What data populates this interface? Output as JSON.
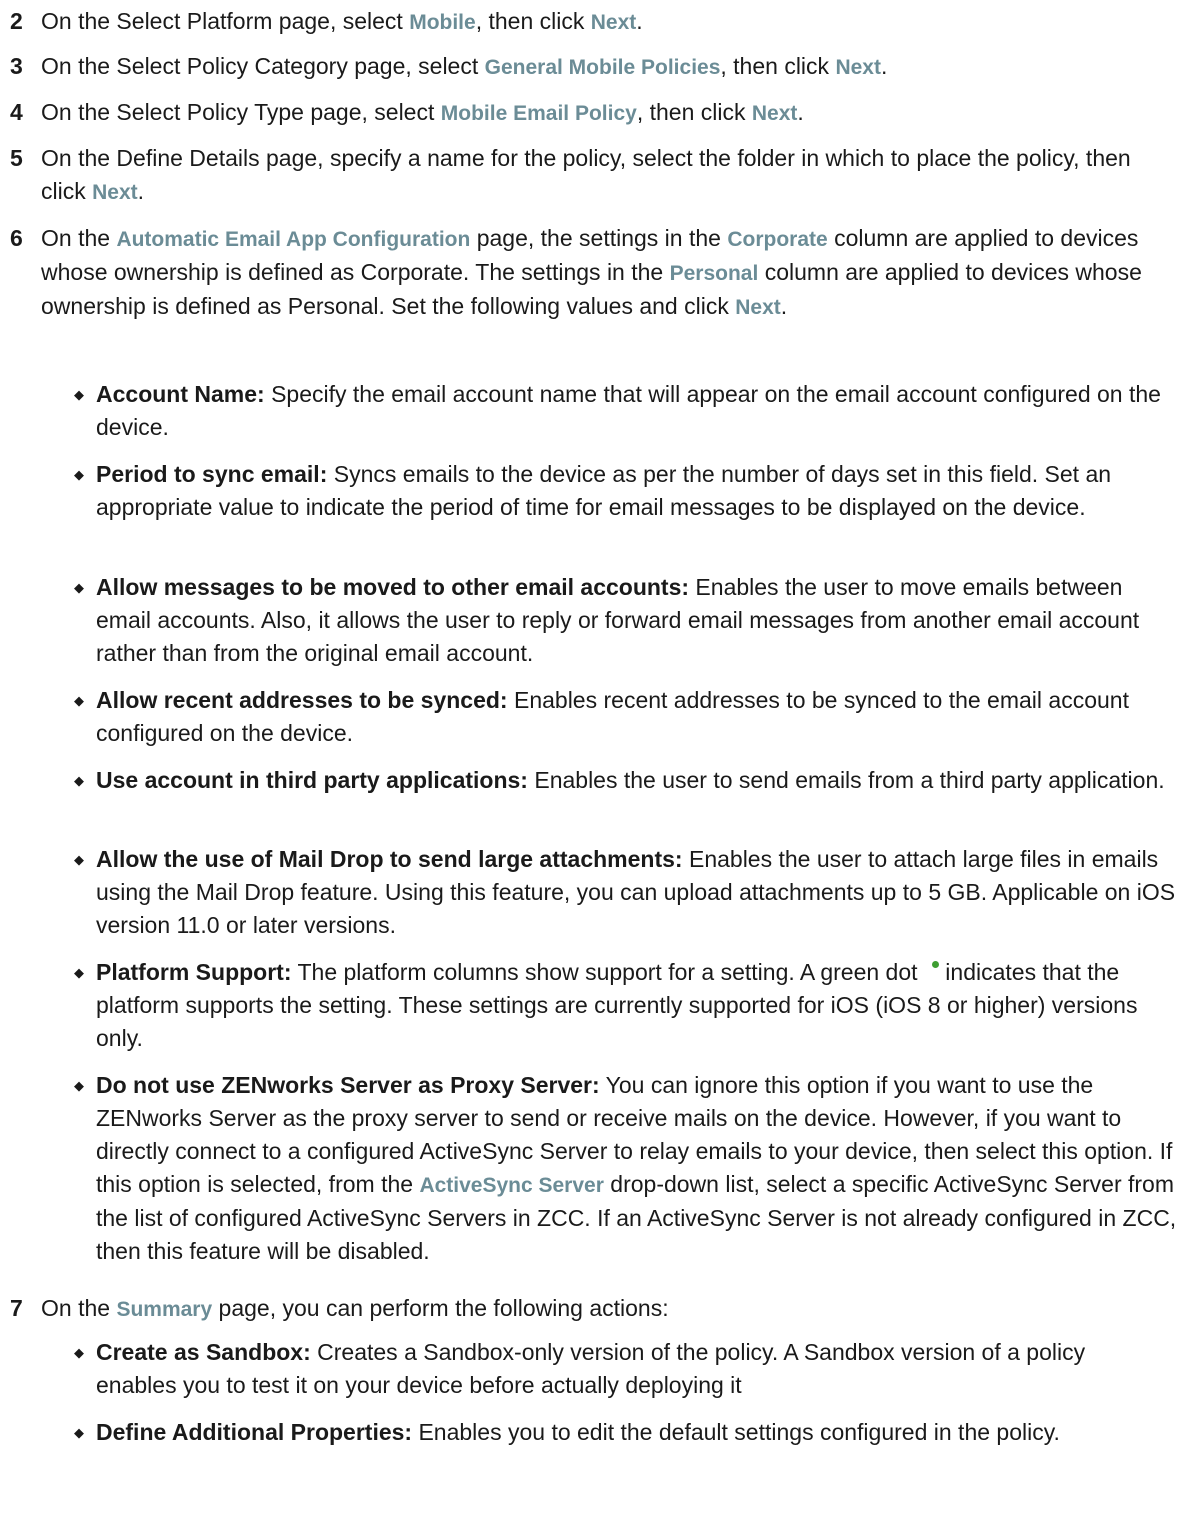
{
  "steps": [
    {
      "num": "2",
      "parts": [
        "On the Select Platform page, select ",
        "Mobile",
        ", then click ",
        "Next",
        "."
      ]
    },
    {
      "num": "3",
      "parts": [
        "On the Select Policy Category page, select ",
        "General Mobile Policies",
        ", then click ",
        "Next",
        "."
      ]
    },
    {
      "num": "4",
      "parts": [
        "On the Select Policy Type page, select ",
        "Mobile Email Policy",
        ", then click ",
        "Next",
        "."
      ]
    },
    {
      "num": "5",
      "parts": [
        "On the Define Details page, specify a name for the policy, select the folder in which to place the policy, then click ",
        "Next",
        "."
      ]
    },
    {
      "num": "6",
      "parts": [
        "On the ",
        "Automatic Email App Configuration",
        " page, the settings in the ",
        "Corporate",
        " column are applied to devices whose ownership is defined as Corporate. The settings in the ",
        "Personal",
        " column are applied to devices whose ownership is defined as Personal. Set the following values and click ",
        "Next",
        "."
      ]
    },
    {
      "num": "7",
      "parts": [
        "On the ",
        "Summary",
        " page, you can perform the following actions:"
      ]
    }
  ],
  "step6_bullets": [
    {
      "term": "Account Name:",
      "text": " Specify the email account name that will appear on the email account configured on the device."
    },
    {
      "term": "Period to sync email:",
      "text": " Syncs emails to the device as per the number of days set in this field. Set an appropriate value to indicate the period of time for email messages to be displayed on the device."
    },
    {
      "term": "Allow messages to be moved to other email accounts:",
      "text": " Enables the user to move emails between email accounts. Also, it allows the user to reply or forward email messages from another email account rather than from the original email account."
    },
    {
      "term": "Allow recent addresses to be synced:",
      "text": " Enables recent addresses to be synced to the email account configured on the device."
    },
    {
      "term": "Use account in third party applications:",
      "text": " Enables the user to send emails from a third party application."
    },
    {
      "term": "Allow the use of Mail Drop to send large attachments:",
      "text": "  Enables the user to attach large files in emails using the Mail Drop feature. Using this feature, you can upload attachments up to 5 GB. Applicable on iOS version 11.0 or later versions."
    },
    {
      "term": "Platform Support:",
      "text_before_dot": " The platform columns show support for a setting. A green dot ",
      "text_after_dot": " indicates that the platform supports the setting. These settings are currently supported for iOS (iOS 8 or higher) versions only."
    },
    {
      "term": "Do not use ZENworks Server as Proxy Server:",
      "text": " You can ignore this option if you want to use the ZENworks Server as the proxy server to send or receive mails on the device. However, if you want to directly connect to a configured ActiveSync Server to relay emails to your device, then select this option. If this option is selected, from the ",
      "ui": "ActiveSync Server",
      "text_after": " drop-down list, select a specific ActiveSync Server from the list of configured ActiveSync Servers in ZCC. If an ActiveSync Server is not already configured in ZCC, then this feature will be disabled."
    }
  ],
  "step7_bullets": [
    {
      "term": "Create as Sandbox:",
      "text": " Creates a Sandbox-only version of the policy. A Sandbox version of a policy enables you to test it on your device before actually deploying it"
    },
    {
      "term": "Define Additional Properties:",
      "text": " Enables you to edit the default settings configured in the policy."
    }
  ],
  "bullet_glyph": "◆",
  "colors": {
    "ui_term": "#6b8c96",
    "green_dot": "#3e9e32",
    "text": "#1a1a1a"
  }
}
